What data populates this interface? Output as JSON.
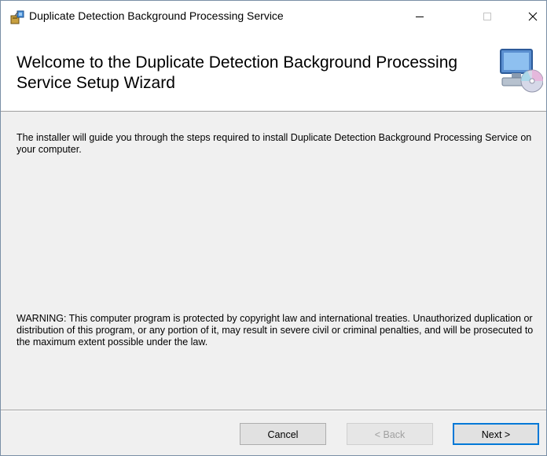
{
  "window": {
    "title": "Duplicate Detection Background Processing Service",
    "icons": {
      "app": "installer-box-icon",
      "minimize": "minimize-icon",
      "maximize": "maximize-icon",
      "close": "close-icon"
    }
  },
  "header": {
    "title": "Welcome to the Duplicate Detection Background Processing Service Setup Wizard",
    "icon": "computer-cd-icon"
  },
  "body": {
    "intro": "The installer will guide you through the steps required to install Duplicate Detection Background Processing Service on your computer.",
    "warning": "WARNING: This computer program is protected by copyright law and international treaties. Unauthorized duplication or distribution of this program, or any portion of it, may result in severe civil or criminal penalties, and will be prosecuted to the maximum extent possible under the law."
  },
  "buttons": {
    "cancel": "Cancel",
    "back": "< Back",
    "next": "Next >"
  },
  "colors": {
    "accent": "#0078d7",
    "disabled_text": "#a0a0a0",
    "dialog_bg": "#f0f0f0"
  }
}
